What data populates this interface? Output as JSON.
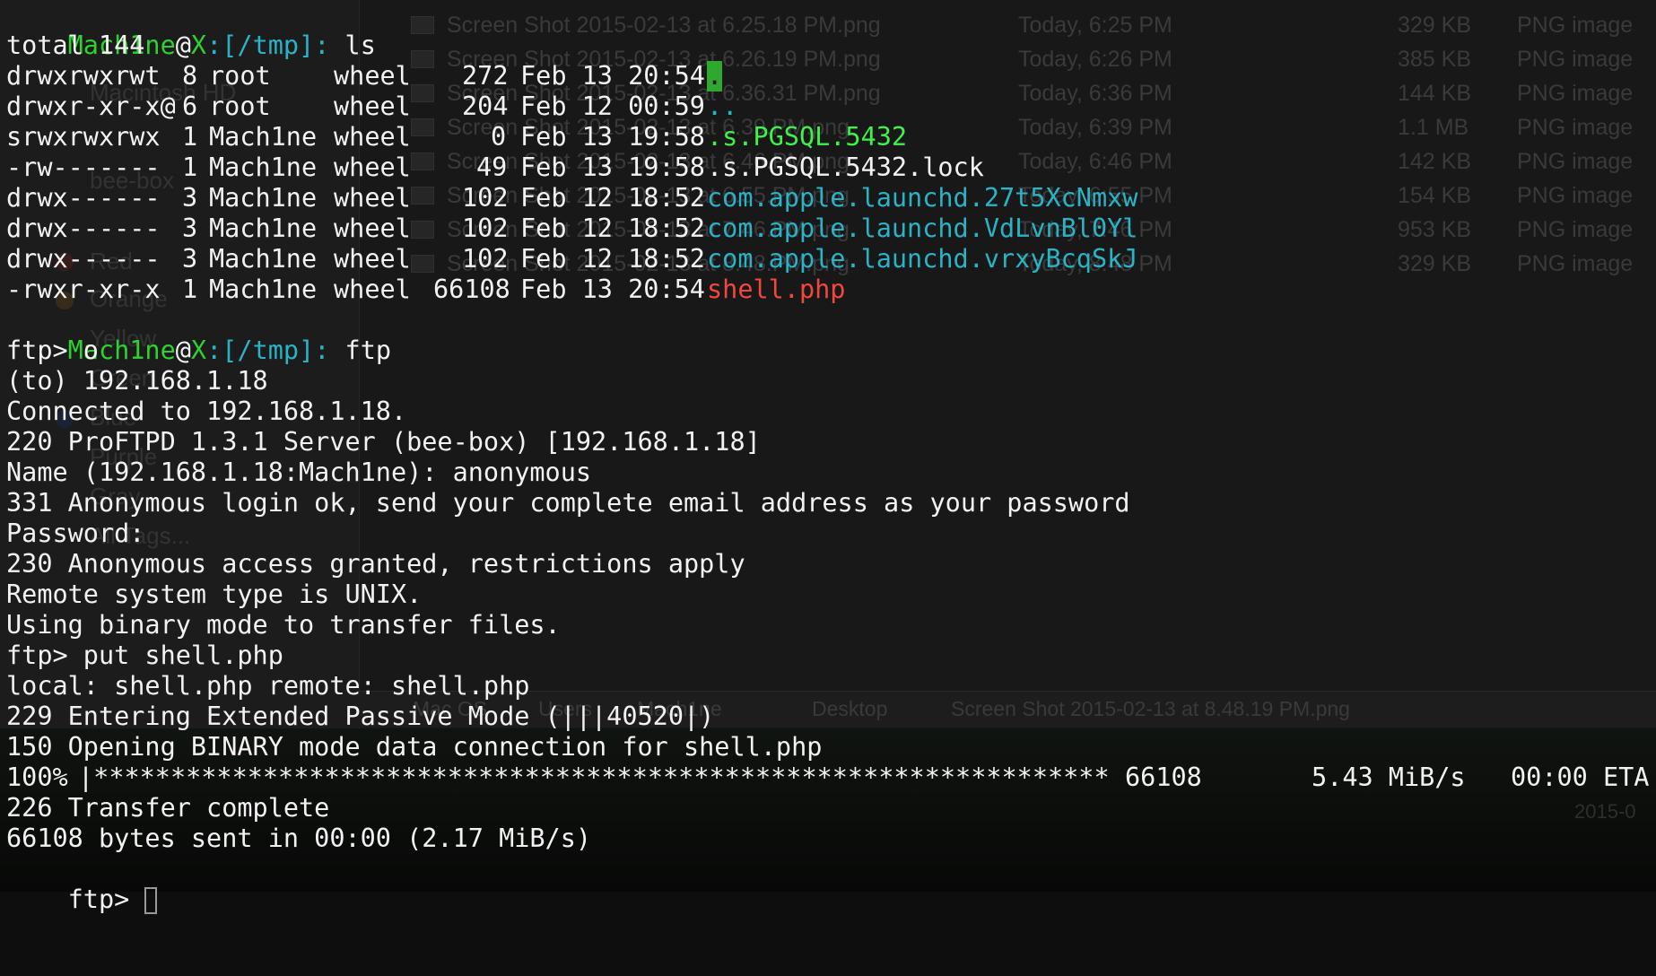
{
  "colors": {
    "green": "#2fd12f",
    "cyan": "#2ab3c6",
    "red": "#f2473e",
    "text": "#f2f2f2"
  },
  "background_finder": {
    "files": [
      {
        "name": "Screen Shot 2015-02-13 at 6.25.18 PM.png",
        "date": "Today, 6:25 PM",
        "size": "329 KB",
        "kind": "PNG image"
      },
      {
        "name": "Screen Shot 2015-02-13 at 6.26.19 PM.png",
        "date": "Today, 6:26 PM",
        "size": "385 KB",
        "kind": "PNG image"
      },
      {
        "name": "Screen Shot 2015-02-13 at 6.36.31 PM.png",
        "date": "Today, 6:36 PM",
        "size": "144 KB",
        "kind": "PNG image"
      },
      {
        "name": "Screen Shot 2015-02-13 at 6.39.PM.png",
        "date": "Today, 6:39 PM",
        "size": "1.1 MB",
        "kind": "PNG image"
      },
      {
        "name": "Screen Shot 2015-02-13 at 6.46.PM.png",
        "date": "Today, 6:46 PM",
        "size": "142 KB",
        "kind": "PNG image"
      },
      {
        "name": "Screen Shot 2015-02-13 at 6.55.PM.png",
        "date": "Today, 6:55 PM",
        "size": "154 KB",
        "kind": "PNG image"
      },
      {
        "name": "Screen Shot 2015-02-13 at 7.46.PM.png",
        "date": "Today, 7:46 PM",
        "size": "953 KB",
        "kind": "PNG image"
      },
      {
        "name": "Screen Shot 2015-02-13 at 8.48.PM.png",
        "date": "Today, 8:48 PM",
        "size": "329 KB",
        "kind": "PNG image"
      }
    ],
    "sidebar": [
      "Macintosh HD",
      "bee-box",
      "Red",
      "Orange",
      "Yellow",
      "Green",
      "Blue",
      "Purple",
      "Gray",
      "All Tags..."
    ],
    "pathbar": [
      "Mac OS",
      "Users",
      "Mach1ne",
      "Desktop",
      "Screen Shot 2015-02-13 at 8.48.19 PM.png"
    ],
    "corner_text": "2015-0"
  },
  "terminal": {
    "prompt_user": "Mach1ne",
    "prompt_at": "@",
    "prompt_host": "X",
    "prompt_path": ":[/tmp]:",
    "cmd_ls": " ls",
    "cmd_ftp": " ftp",
    "total": "total 144",
    "listing": [
      {
        "perms": "drwxrwxrwt",
        "links": "8",
        "owner": "root",
        "group": "wheel",
        "size": "272",
        "date": "Feb 13 20:54",
        "name": ".",
        "color": "bgreen"
      },
      {
        "perms": "drwxr-xr-x@",
        "links": "6",
        "owner": "root",
        "group": "wheel",
        "size": "204",
        "date": "Feb 12 00:59",
        "name": "..",
        "color": "cyan"
      },
      {
        "perms": "srwxrwxrwx",
        "links": "1",
        "owner": "Mach1ne",
        "group": "wheel",
        "size": "0",
        "date": "Feb 13 19:58",
        "name": ".s.PGSQL.5432",
        "color": "green"
      },
      {
        "perms": "-rw-------",
        "links": "1",
        "owner": "Mach1ne",
        "group": "wheel",
        "size": "49",
        "date": "Feb 13 19:58",
        "name": ".s.PGSQL.5432.lock",
        "color": "white"
      },
      {
        "perms": "drwx------",
        "links": "3",
        "owner": "Mach1ne",
        "group": "wheel",
        "size": "102",
        "date": "Feb 12 18:52",
        "name": "com.apple.launchd.27t5XcNmxw",
        "color": "cyan"
      },
      {
        "perms": "drwx------",
        "links": "3",
        "owner": "Mach1ne",
        "group": "wheel",
        "size": "102",
        "date": "Feb 12 18:52",
        "name": "com.apple.launchd.VdLvnBl0Yl",
        "color": "cyan"
      },
      {
        "perms": "drwx------",
        "links": "3",
        "owner": "Mach1ne",
        "group": "wheel",
        "size": "102",
        "date": "Feb 12 18:52",
        "name": "com.apple.launchd.vrxyBcqSkJ",
        "color": "cyan"
      },
      {
        "perms": "-rwxr-xr-x",
        "links": "1",
        "owner": "Mach1ne",
        "group": "wheel",
        "size": "66108",
        "date": "Feb 13 20:54",
        "name": "shell.php",
        "color": "red"
      }
    ],
    "ftp_lines": [
      "ftp> o",
      "(to) 192.168.1.18",
      "Connected to 192.168.1.18.",
      "220 ProFTPD 1.3.1 Server (bee-box) [192.168.1.18]",
      "Name (192.168.1.18:Mach1ne): anonymous",
      "331 Anonymous login ok, send your complete email address as your password",
      "Password:",
      "230 Anonymous access granted, restrictions apply",
      "Remote system type is UNIX.",
      "Using binary mode to transfer files.",
      "ftp> put shell.php",
      "local: shell.php remote: shell.php",
      "229 Entering Extended Passive Mode (|||40520|)",
      "150 Opening BINARY mode data connection for shell.php"
    ],
    "progress": {
      "percent_text": "100%",
      "bar": "|*******************************************************************|",
      "bytes": "66108",
      "rate": "5.43 MiB/s",
      "eta": "00:00 ETA",
      "fraction": 1.0
    },
    "after_lines": [
      "226 Transfer complete",
      "66108 bytes sent in 00:00 (2.17 MiB/s)"
    ],
    "final_prompt": "ftp> "
  }
}
